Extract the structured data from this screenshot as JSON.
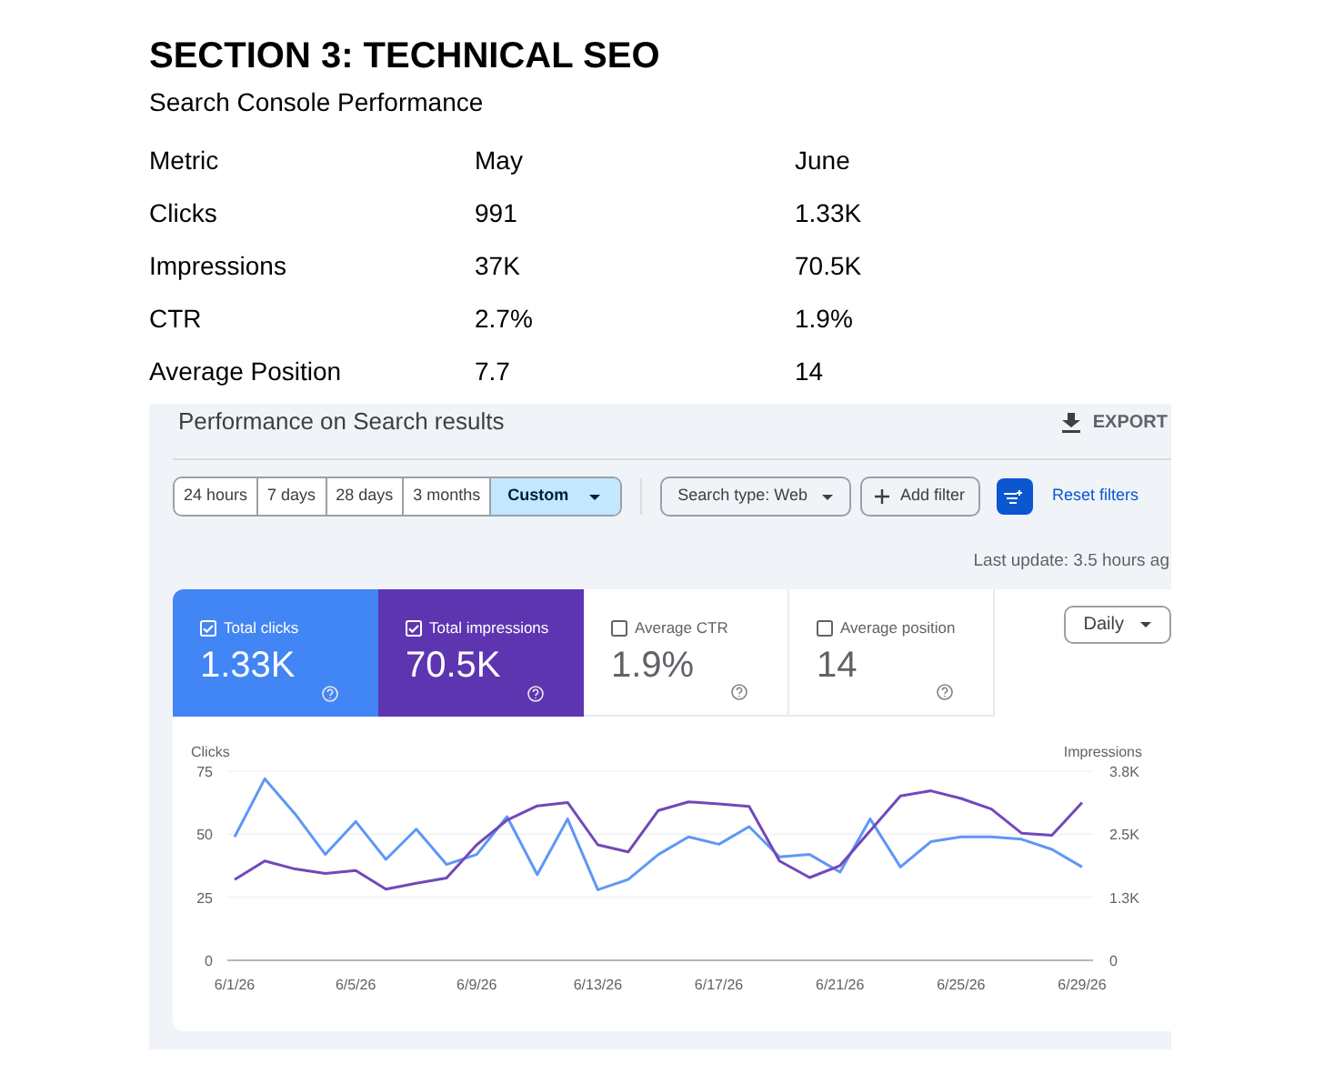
{
  "heading": "SECTION 3: TECHNICAL SEO",
  "subheading": "Search Console Performance",
  "table": {
    "columns": [
      "Metric",
      "May",
      "June"
    ],
    "rows": [
      [
        "Clicks",
        "991",
        "1.33K"
      ],
      [
        "Impressions",
        "37K",
        "70.5K"
      ],
      [
        "CTR",
        "2.7%",
        "1.9%"
      ],
      [
        "Average Position",
        "7.7",
        "14"
      ]
    ]
  },
  "screenshot": {
    "title": "Performance on Search results",
    "export": "EXPORT",
    "date_ranges": [
      {
        "label": "24 hours",
        "selected": false
      },
      {
        "label": "7 days",
        "selected": false
      },
      {
        "label": "28 days",
        "selected": false
      },
      {
        "label": "3 months",
        "selected": false
      },
      {
        "label": "Custom",
        "selected": true
      }
    ],
    "search_type": "Search type: Web",
    "add_filter": "Add filter",
    "reset_filters": "Reset filters",
    "last_update": "Last update: 3.5 hours ag",
    "metrics": [
      {
        "label": "Total clicks",
        "value": "1.33K",
        "checked": true,
        "color": "#4285f4"
      },
      {
        "label": "Total impressions",
        "value": "70.5K",
        "checked": true,
        "color": "#5e35b1"
      },
      {
        "label": "Average CTR",
        "value": "1.9%",
        "checked": false
      },
      {
        "label": "Average position",
        "value": "14",
        "checked": false
      }
    ],
    "granularity": "Daily",
    "chart_data": {
      "type": "line",
      "ylabel": "Clicks",
      "y2label": "Impressions",
      "categories": [
        "6/1/26",
        null,
        null,
        null,
        "6/5/26",
        null,
        null,
        null,
        "6/9/26",
        null,
        null,
        null,
        "6/13/26",
        null,
        null,
        null,
        "6/17/26",
        null,
        null,
        null,
        "6/21/26",
        null,
        null,
        null,
        "6/25/26",
        null,
        null,
        null,
        "6/29/26"
      ],
      "ylim": [
        0,
        75
      ],
      "yticks": [
        0,
        25,
        50,
        75
      ],
      "y2lim": [
        0,
        3750
      ],
      "y2ticks": [
        {
          "value": 0,
          "label": "0"
        },
        {
          "value": 1250,
          "label": "1.3K"
        },
        {
          "value": 2500,
          "label": "2.5K"
        },
        {
          "value": 3750,
          "label": "3.8K"
        }
      ],
      "series": [
        {
          "color": "#5e97f6",
          "values": [
            49,
            72,
            58,
            42,
            55,
            40,
            52,
            38,
            42,
            57,
            34,
            56,
            28,
            32,
            42,
            49,
            46,
            53,
            41,
            42,
            35,
            56,
            37,
            47,
            49,
            49,
            48,
            44,
            37
          ]
        },
        {
          "color": "#7248b9",
          "axis": "y2",
          "values": [
            1600,
            1970,
            1810,
            1720,
            1780,
            1410,
            1530,
            1630,
            2290,
            2780,
            3060,
            3130,
            2290,
            2150,
            2970,
            3140,
            3100,
            3050,
            1970,
            1640,
            1880,
            2570,
            3260,
            3360,
            3210,
            3000,
            2520,
            2480,
            3130
          ]
        }
      ]
    }
  }
}
